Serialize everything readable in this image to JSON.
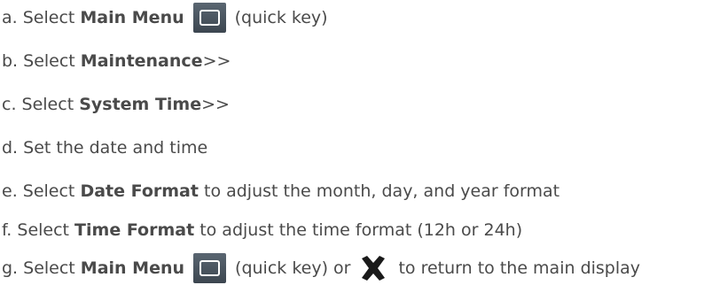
{
  "steps": [
    {
      "prefix": "a. Select ",
      "bold": "Main Menu",
      "icon": "main-menu-key-icon",
      "suffix": "(quick key)"
    },
    {
      "prefix": "b. Select ",
      "bold": "Maintenance",
      "suffix": ">>"
    },
    {
      "prefix": "c. Select ",
      "bold": "System Time",
      "suffix": ">>"
    },
    {
      "text": "d. Set the date and time"
    },
    {
      "prefix": "e. Select ",
      "bold": "Date Format",
      "suffix": " to adjust the month, day, and year format"
    },
    {
      "prefix": "f. Select ",
      "bold": "Time Format",
      "suffix": " to adjust the time format (12h or 24h)"
    },
    {
      "prefix": "g. Select ",
      "bold": "Main Menu",
      "icon": "main-menu-key-icon",
      "middle": "(quick key) or",
      "icon2": "close-x-icon",
      "suffix": "to return to the main display"
    }
  ],
  "colors": {
    "text": "#4a4a4a",
    "key_background": "#4b5560",
    "close_x": "#1a1a1a"
  }
}
